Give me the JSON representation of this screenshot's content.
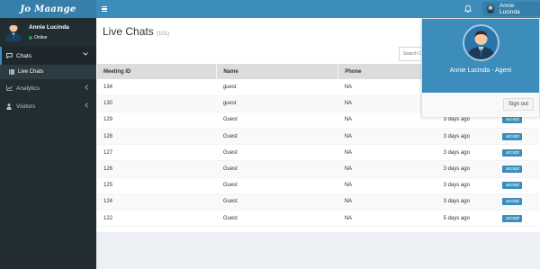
{
  "brand": {
    "logo_text": "Jo Maange"
  },
  "topbar": {
    "user_name": "Annie Lucinda"
  },
  "sidebar": {
    "user_name": "Annie Lucinda",
    "status": "Online",
    "nav": {
      "chats": "Chats",
      "live_chats": "Live Chats",
      "analytics": "Analytics",
      "visitors": "Visitors"
    }
  },
  "page": {
    "title": "Live Chats",
    "count": "(101)",
    "search_placeholder": "Search C"
  },
  "table": {
    "headers": [
      "Meeting ID",
      "Name",
      "Phone"
    ],
    "rows": [
      {
        "id": "134",
        "name": "guest",
        "phone": "NA",
        "time": "",
        "action": ""
      },
      {
        "id": "130",
        "name": "guest",
        "phone": "NA",
        "time": "",
        "action": ""
      },
      {
        "id": "129",
        "name": "Guest",
        "phone": "NA",
        "time": "3 days ago",
        "action": "accept"
      },
      {
        "id": "128",
        "name": "Guest",
        "phone": "NA",
        "time": "3 days ago",
        "action": "accept"
      },
      {
        "id": "127",
        "name": "Guest",
        "phone": "NA",
        "time": "3 days ago",
        "action": "accept"
      },
      {
        "id": "126",
        "name": "Guest",
        "phone": "NA",
        "time": "3 days ago",
        "action": "accept"
      },
      {
        "id": "125",
        "name": "Guest",
        "phone": "NA",
        "time": "3 days ago",
        "action": "accept"
      },
      {
        "id": "124",
        "name": "Guest",
        "phone": "NA",
        "time": "3 days ago",
        "action": "accept"
      },
      {
        "id": "122",
        "name": "Guest",
        "phone": "NA",
        "time": "5 days ago",
        "action": "accept"
      }
    ]
  },
  "dropdown": {
    "role": "Annie Lucinda - Agent",
    "signout": "Sign out"
  },
  "colors": {
    "primary": "#3c8dbc",
    "primary_dark": "#367fa9",
    "sidebar_bg": "#222d32",
    "online": "#00a65a"
  },
  "icons": [
    "hamburger-icon",
    "bell-icon",
    "comments-icon",
    "list-icon",
    "chart-icon",
    "user-icon",
    "chevron-down-icon",
    "chevron-left-icon"
  ]
}
